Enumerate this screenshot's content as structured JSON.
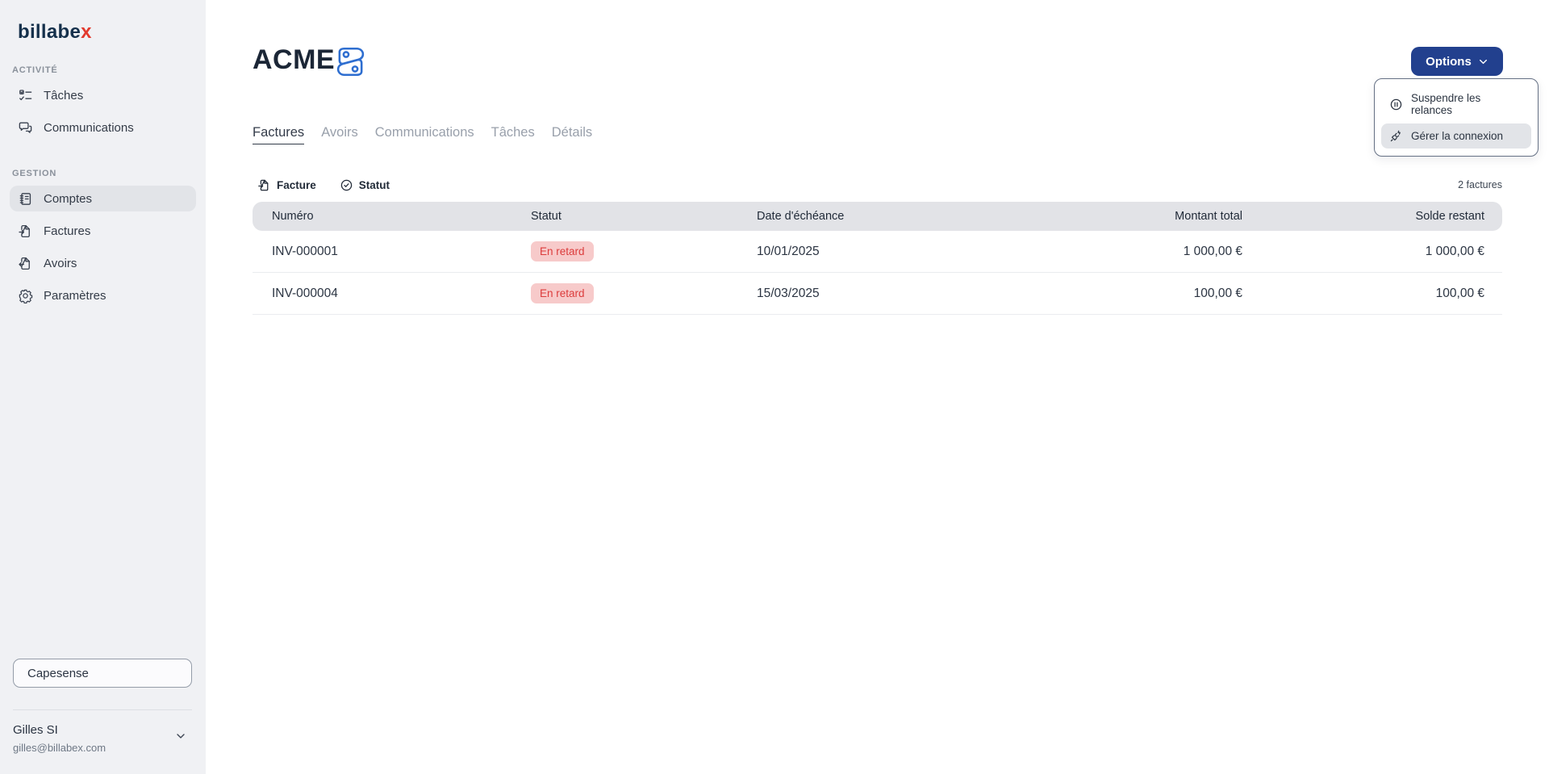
{
  "brand": {
    "name_main": "billabe",
    "name_accent": "x"
  },
  "sidebar": {
    "sections": [
      {
        "label": "ACTIVITÉ",
        "items": [
          {
            "label": "Tâches",
            "icon": "checklist-icon"
          },
          {
            "label": "Communications",
            "icon": "chat-bubbles-icon"
          }
        ]
      },
      {
        "label": "GESTION",
        "items": [
          {
            "label": "Comptes",
            "icon": "ledger-icon",
            "active": true
          },
          {
            "label": "Factures",
            "icon": "file-import-icon"
          },
          {
            "label": "Avoirs",
            "icon": "file-export-icon"
          },
          {
            "label": "Paramètres",
            "icon": "gear-icon"
          }
        ]
      }
    ],
    "company_selector": {
      "value": "Capesense"
    },
    "user": {
      "name": "Gilles SI",
      "email": "gilles@billabex.com"
    }
  },
  "header": {
    "title": "ACME",
    "title_icon": "zoho-books-icon",
    "options_label": "Options"
  },
  "menu": {
    "items": [
      {
        "label": "Suspendre les relances",
        "icon": "pause-circle-icon"
      },
      {
        "label": "Gérer la connexion",
        "icon": "plug-zap-icon",
        "hovered": true
      }
    ]
  },
  "tabs": [
    {
      "label": "Factures",
      "active": true
    },
    {
      "label": "Avoirs"
    },
    {
      "label": "Communications"
    },
    {
      "label": "Tâches"
    },
    {
      "label": "Détails"
    }
  ],
  "filters": [
    {
      "label": "Facture",
      "icon": "invoice-icon"
    },
    {
      "label": "Statut",
      "icon": "status-check-icon"
    }
  ],
  "invoices": {
    "count_label": "2 factures",
    "columns": [
      "Numéro",
      "Statut",
      "Date d'échéance",
      "Montant total",
      "Solde restant"
    ],
    "rows": [
      {
        "numero": "INV-000001",
        "statut": "En retard",
        "date": "10/01/2025",
        "montant": "1 000,00 €",
        "solde": "1 000,00 €"
      },
      {
        "numero": "INV-000004",
        "statut": "En retard",
        "date": "15/03/2025",
        "montant": "100,00 €",
        "solde": "100,00 €"
      }
    ]
  },
  "colors": {
    "accent_navy": "#22408e",
    "logo_navy": "#15304b",
    "logo_red": "#e23a2e",
    "sidebar_bg": "#f0f1f4",
    "table_header_bg": "#e2e3e7",
    "badge_bg": "#f7caca",
    "badge_text": "#dc3c3c",
    "link_blue": "#2e6ed0"
  }
}
